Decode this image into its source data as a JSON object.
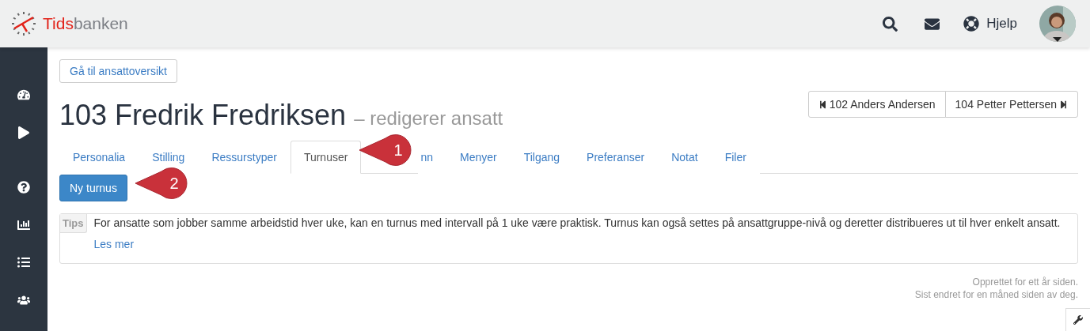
{
  "header": {
    "logo": {
      "brand_red": "Tids",
      "brand_grey": "banken"
    },
    "help_label": "Hjelp"
  },
  "back_button": "Gå til ansattoversikt",
  "title": {
    "name": "103 Fredrik Fredriksen",
    "subtitle": "– redigerer ansatt"
  },
  "pager": {
    "previous": "102 Anders Andersen",
    "next": "104 Petter Pettersen"
  },
  "tabs": [
    {
      "label": "Personalia",
      "selected": false
    },
    {
      "label": "Stilling",
      "selected": false
    },
    {
      "label": "Ressurstyper",
      "selected": false
    },
    {
      "label": "Turnuser",
      "selected": true
    },
    {
      "label": "nn",
      "selected": false
    },
    {
      "label": "Menyer",
      "selected": false
    },
    {
      "label": "Tilgang",
      "selected": false
    },
    {
      "label": "Preferanser",
      "selected": false
    },
    {
      "label": "Notat",
      "selected": false
    },
    {
      "label": "Filer",
      "selected": false
    }
  ],
  "new_button": "Ny turnus",
  "tips": {
    "label": "Tips",
    "text": "For ansatte som jobber samme arbeidstid hver uke, kan en turnus med intervall på 1 uke være praktisk. Turnus kan også settes på ansattgruppe-nivå og deretter distribueres ut til hver enkelt ansatt.",
    "link": "Les mer"
  },
  "footer": {
    "created": "Opprettet for ett år siden.",
    "modified": "Sist endret for en måned siden av deg."
  },
  "callouts": [
    {
      "number": "1"
    },
    {
      "number": "2"
    }
  ]
}
